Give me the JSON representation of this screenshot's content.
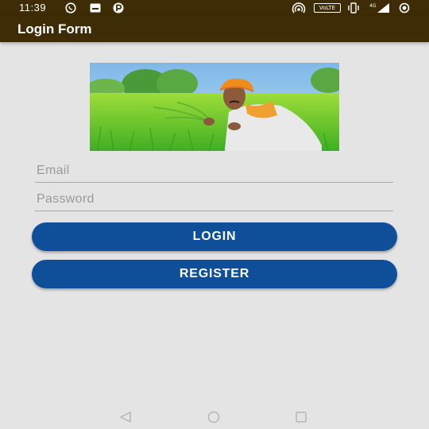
{
  "status_bar": {
    "time": "11:39",
    "volte": "VoLTE",
    "icons": [
      "whatsapp-icon",
      "message-icon",
      "p-app-icon",
      "hotspot-icon",
      "vibrate-icon",
      "signal-icon",
      "battery-icon"
    ]
  },
  "app_bar": {
    "title": "Login Form"
  },
  "hero": {
    "image": "farmer-in-field-image"
  },
  "form": {
    "email_placeholder": "Email",
    "email_value": "",
    "password_placeholder": "Password",
    "password_value": ""
  },
  "buttons": {
    "login_label": "LOGIN",
    "register_label": "REGISTER"
  },
  "nav_bar": {
    "icons": [
      "back-icon",
      "home-icon",
      "recents-icon"
    ]
  },
  "colors": {
    "app_bar": "#3d2c06",
    "button": "#0f4f9a",
    "background": "#e4e4e4"
  }
}
